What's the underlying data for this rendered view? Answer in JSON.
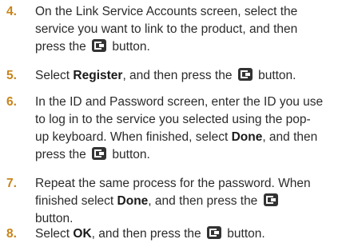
{
  "enter_button_icon": "enter-button-icon",
  "colors": {
    "step_number": "#c8841a",
    "text": "#2b2b2b",
    "icon": "#333333"
  },
  "steps": [
    {
      "number": "4.",
      "lines": [
        "On the Link Service Accounts screen, select the",
        "service you want to link to the product, and then",
        "press the",
        "button."
      ]
    },
    {
      "number": "5.",
      "pre": "Select",
      "bold": "Register",
      "mid": ", and then press the",
      "post": "button."
    },
    {
      "number": "6.",
      "line1": "In the ID and Password screen, enter the ID you use",
      "line2": "to log in to the service you selected using the pop-",
      "line3_pre": "up keyboard. When finished, select",
      "line3_bold": "Done",
      "line3_post": ", and then",
      "line4_pre": "press the",
      "line4_post": "button."
    },
    {
      "number": "7.",
      "line1": "Repeat the same process for the password. When",
      "line2_pre": "finished select",
      "line2_bold": "Done",
      "line2_post": ", and then press the",
      "line3": "button."
    },
    {
      "number": "8.",
      "pre": "Select",
      "bold": "OK",
      "mid": ", and then press the",
      "post": "button."
    }
  ]
}
